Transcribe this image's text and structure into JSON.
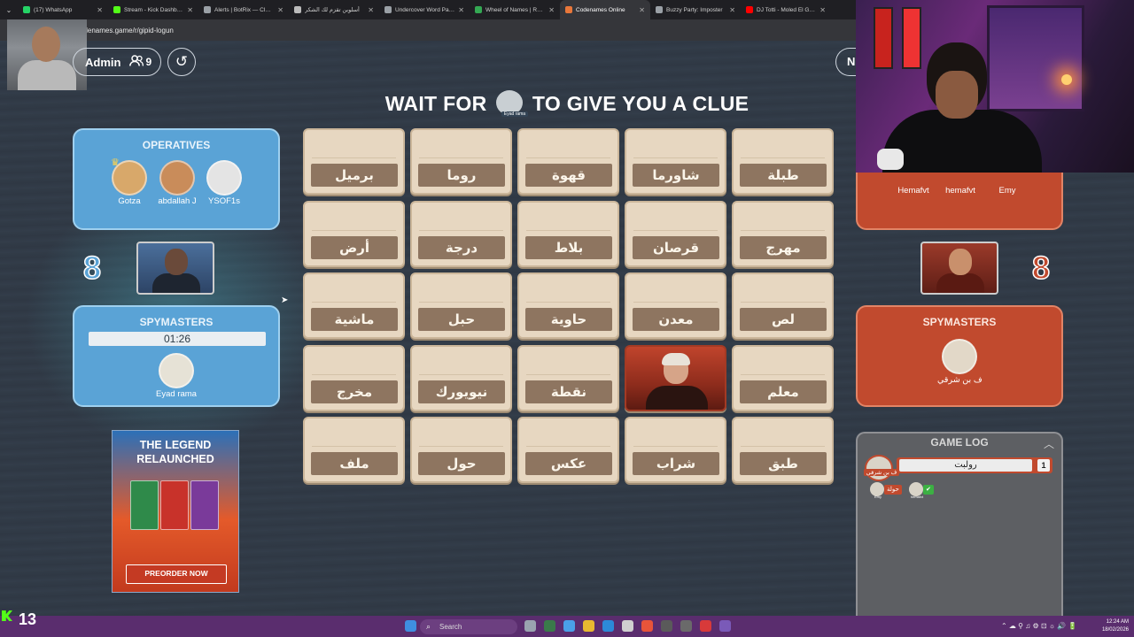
{
  "browser": {
    "tabs": [
      {
        "title": "(17) WhatsApp",
        "favicon_color": "#25d366",
        "active": false
      },
      {
        "title": "Stream - Kick Dashboard",
        "favicon_color": "#53fc18",
        "active": false
      },
      {
        "title": "Alerts | BotRix — Cloud",
        "favicon_color": "#9aa0a6",
        "active": false
      },
      {
        "title": "أسلوبن تقزم لك الشكر",
        "favicon_color": "#bbbbbb",
        "active": false
      },
      {
        "title": "Undercover Word Party",
        "favicon_color": "#9aa0a6",
        "active": false
      },
      {
        "title": "Wheel of Names | Rando",
        "favicon_color": "#34a853",
        "active": false
      },
      {
        "title": "Codenames Online",
        "favicon_color": "#e8773a",
        "active": true
      },
      {
        "title": "Buzzy Party: Imposter",
        "favicon_color": "#9aa0a6",
        "active": false
      },
      {
        "title": "DJ Totti - Moled El Gezo",
        "favicon_color": "#ff0000",
        "active": false
      }
    ],
    "url": "codenames.game/r/gipid-logun"
  },
  "header": {
    "admin_label": "Admin",
    "player_count": "9",
    "right_button_label": "N"
  },
  "title": {
    "before": "WAIT FOR",
    "after": "TO GIVE YOU A CLUE",
    "avatar_caption": "Eyad rama"
  },
  "blue_team": {
    "color": "#5aa3d6",
    "score": "8",
    "operatives_heading": "OPERATIVES",
    "operatives": [
      "Gotza",
      "abdallah J",
      "YSOF1s"
    ],
    "spymasters_heading": "SPYMASTERS",
    "timer": "01:26",
    "spymasters": [
      "Eyad rama"
    ]
  },
  "red_team": {
    "color": "#c14a2e",
    "score": "8",
    "operatives": [
      "Hemafvt",
      "hemafvt",
      "Emy"
    ],
    "spymasters_heading": "SPYMASTERS",
    "spymasters": [
      "ف بن شرقي"
    ]
  },
  "board": {
    "cards": [
      {
        "word": "برميل",
        "revealed": ""
      },
      {
        "word": "روما",
        "revealed": ""
      },
      {
        "word": "قهوة",
        "revealed": ""
      },
      {
        "word": "شاورما",
        "revealed": ""
      },
      {
        "word": "طبلة",
        "revealed": ""
      },
      {
        "word": "أرض",
        "revealed": ""
      },
      {
        "word": "درجة",
        "revealed": ""
      },
      {
        "word": "بلاط",
        "revealed": ""
      },
      {
        "word": "قرصان",
        "revealed": ""
      },
      {
        "word": "مهرج",
        "revealed": ""
      },
      {
        "word": "ماشية",
        "revealed": ""
      },
      {
        "word": "حبل",
        "revealed": ""
      },
      {
        "word": "حاوية",
        "revealed": ""
      },
      {
        "word": "معدن",
        "revealed": ""
      },
      {
        "word": "لص",
        "revealed": ""
      },
      {
        "word": "مخرج",
        "revealed": ""
      },
      {
        "word": "نيويورك",
        "revealed": ""
      },
      {
        "word": "نقطة",
        "revealed": ""
      },
      {
        "word": "",
        "revealed": "red"
      },
      {
        "word": "معلم",
        "revealed": ""
      },
      {
        "word": "ملف",
        "revealed": ""
      },
      {
        "word": "حول",
        "revealed": ""
      },
      {
        "word": "عكس",
        "revealed": ""
      },
      {
        "word": "شراب",
        "revealed": ""
      },
      {
        "word": "طبق",
        "revealed": ""
      }
    ]
  },
  "promo": {
    "title_line1": "THE LEGEND",
    "title_line2": "RELAUNCHED",
    "button": "PREORDER NOW"
  },
  "game_log": {
    "heading": "GAME LOG",
    "clue_word": "رولبت",
    "clue_number": "1",
    "clue_author": "ف بن شرقي",
    "guesses": [
      {
        "word": "حولة",
        "color": "#c14a2e",
        "name": "Emy"
      },
      {
        "word": "✔",
        "color": "#3cb043",
        "name": "hemafvt"
      }
    ]
  },
  "overlay": {
    "viewer_count": "13"
  },
  "taskbar": {
    "search_placeholder": "Search",
    "clock_time": "12:24 AM",
    "clock_date": "18/02/2026"
  }
}
